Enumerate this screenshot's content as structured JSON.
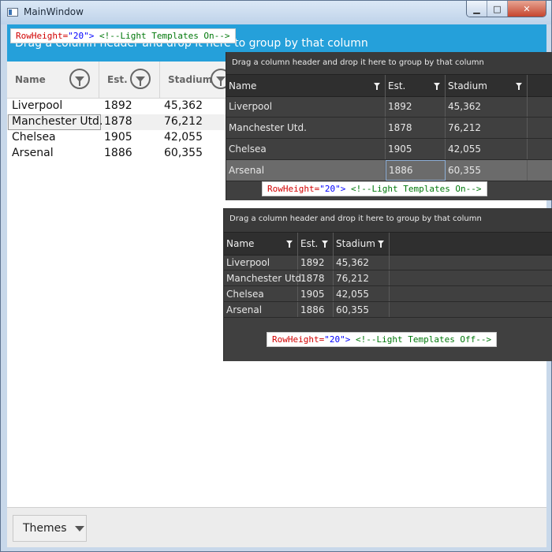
{
  "window": {
    "title": "MainWindow"
  },
  "caption": {
    "minimize": "▁",
    "maximize": "□",
    "close": "✕"
  },
  "code_labels": {
    "attr": "RowHeight=",
    "value": "\"20\"",
    "close": ">",
    "comment_on": "<!--Light Templates On-->",
    "comment_off": "<!--Light Templates Off-->"
  },
  "group_panel_text": "Drag a column header and drop it here to group by that column",
  "columns": [
    "Name",
    "Est.",
    "Stadium"
  ],
  "rows": [
    [
      "Liverpool",
      "1892",
      "45,362"
    ],
    [
      "Manchester Utd.",
      "1878",
      "76,212"
    ],
    [
      "Chelsea",
      "1905",
      "42,055"
    ],
    [
      "Arsenal",
      "1886",
      "60,355"
    ]
  ],
  "bottom": {
    "themes_label": "Themes"
  },
  "icons": {
    "filter": "filter-icon",
    "dropdown": "chevron-down-icon",
    "window": "window-icon"
  }
}
